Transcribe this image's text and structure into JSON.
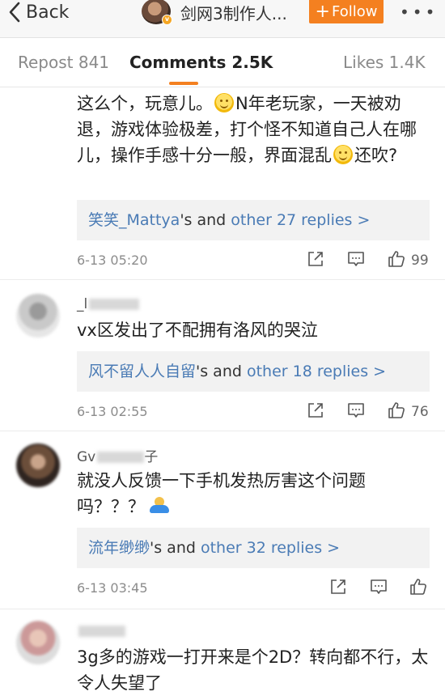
{
  "header": {
    "back_label": "Back",
    "title": "剑网3制作人...",
    "follow_label": "Follow",
    "more_label": "•••",
    "accent_color": "#f48020"
  },
  "tabs": [
    {
      "label": "Repost 841",
      "active": false
    },
    {
      "label": "Comments 2.5K",
      "active": true
    },
    {
      "label": "Likes 1.4K",
      "active": false
    }
  ],
  "comments": [
    {
      "text_parts": [
        "这么个，玩意儿。",
        "N年老玩家，一天被劝退，游戏体验极差，打个怪不知道自己人在哪儿，操作手感十分一般，界面混乱",
        "还吹?"
      ],
      "replies_user": "笑笑_Mattya",
      "replies_mid": "'s and ",
      "replies_link": "other 27 replies >",
      "time": "6-13 05:20",
      "likes": "99"
    },
    {
      "username": "_l",
      "text": "vx区发出了不配拥有洛风的哭泣",
      "replies_user": "风不留人人自留",
      "replies_mid": "'s and ",
      "replies_link": "other 18 replies >",
      "time": "6-13 02:55",
      "likes": "76"
    },
    {
      "username_start": "Gv",
      "username_end": "子",
      "text": "就没人反馈一下手机发热厉害这个问题吗？？？",
      "replies_user": "流年缈缈",
      "replies_mid": "'s and ",
      "replies_link": "other 32 replies >",
      "time": "6-13 03:45",
      "likes": ""
    },
    {
      "text": "3g多的游戏一打开来是个2D？转向都不行，太令人失望了"
    }
  ]
}
